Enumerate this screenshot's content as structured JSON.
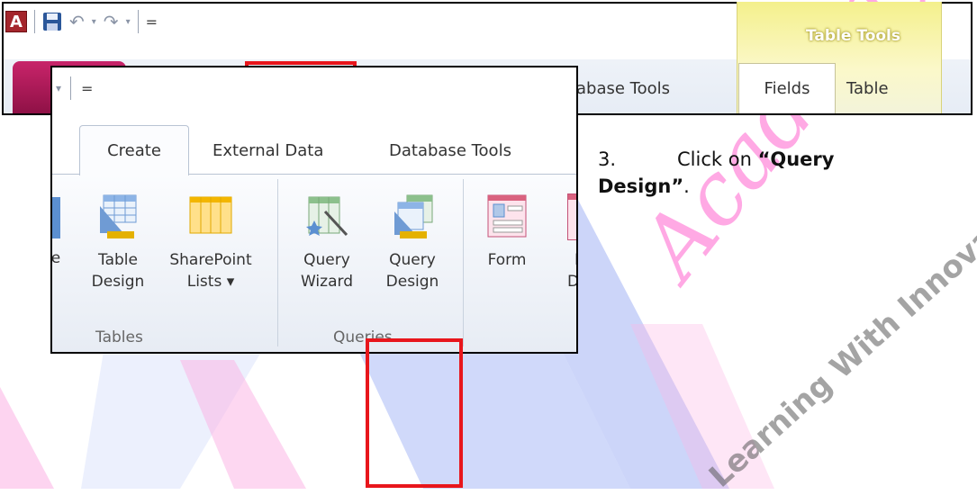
{
  "quick_access": {
    "app_icon_letter": "A",
    "customize_glyph": "="
  },
  "background_ribbon": {
    "contextual_group": "Table Tools",
    "visible_tab_fragment": "abase Tools",
    "tabs": [
      "Fields",
      "Table"
    ]
  },
  "inset": {
    "customize_glyph": "=",
    "tabs": {
      "create": "Create",
      "external_data": "External Data",
      "database_tools": "Database Tools"
    },
    "buttons": {
      "partial_left_fragment": "e",
      "table_design": [
        "Table",
        "Design"
      ],
      "sharepoint_lists": [
        "SharePoint",
        "Lists ▾"
      ],
      "query_wizard": [
        "Query",
        "Wizard"
      ],
      "query_design": [
        "Query",
        "Design"
      ],
      "form": "Form",
      "form_design_fragment": [
        "F",
        "De"
      ]
    },
    "groups": {
      "tables": "Tables",
      "queries": "Queries"
    }
  },
  "instruction": {
    "step": "3.",
    "text_before": "Click on ",
    "emphasis": "“Query Design”",
    "text_after": "."
  },
  "watermark": {
    "word": "Academy",
    "tagline": "Learning With Innovation......",
    "color": "#ff9be0",
    "shape_color": "#a9b9f5"
  },
  "colors": {
    "highlight": "#e8161c",
    "file_tab": "#b01a5a",
    "context_tab": "#f4f08c",
    "access_red": "#a4262c"
  }
}
